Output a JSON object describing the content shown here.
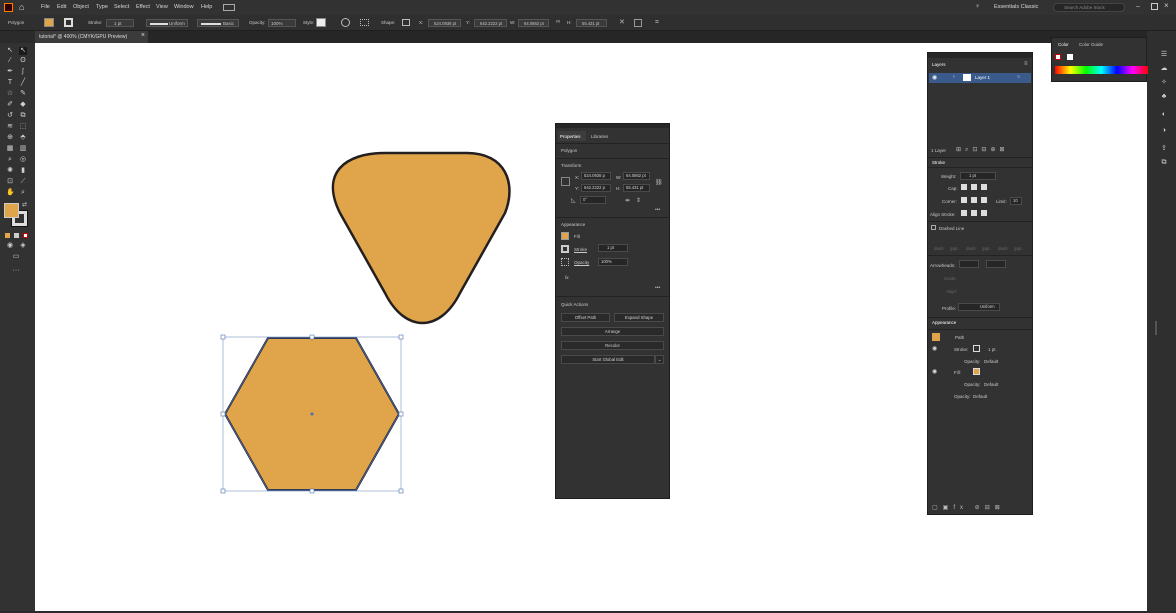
{
  "menu": {
    "app_icon": "illustrator-logo-icon",
    "items": [
      "File",
      "Edit",
      "Object",
      "Type",
      "Select",
      "Effect",
      "View",
      "Window",
      "Help"
    ],
    "workspace": "Essentials Classic",
    "search_placeholder": "Search Adobe Stock"
  },
  "control_bar": {
    "object_type": "Polygon",
    "stroke_label": "Stroke:",
    "stroke_value": "1 pt",
    "profile": "Uniform",
    "brush": "Basic",
    "opacity_label": "Opacity:",
    "opacity_value": "100%",
    "style_label": "Style:",
    "shape_label": "Shape:",
    "x_label": "X:",
    "x_value": "524.0938 pt",
    "y_label": "Y:",
    "y_value": "642.2222 pt",
    "w_label": "W:",
    "w_value": "64.0862 pt",
    "h_label": "H:",
    "h_value": "55.431 pt",
    "fill_color": "#e0a54a"
  },
  "document_tab": {
    "title": "tutorial* @ 400% (CMYK/GPU Preview)"
  },
  "properties_panel": {
    "tabs": [
      "Properties",
      "Libraries"
    ],
    "object_type": "Polygon",
    "transform_label": "Transform",
    "x_label": "X:",
    "x_value": "524.0938 p",
    "y_label": "Y:",
    "y_value": "642.2222 p",
    "w_label": "W:",
    "w_value": "64.0862 pt",
    "h_label": "H:",
    "h_value": "55.431 pt",
    "angle_value": "0°",
    "appearance_label": "Appearance",
    "fill_label": "Fill",
    "stroke_label": "Stroke",
    "stroke_value": "1 pt",
    "opacity_label": "Opacity",
    "opacity_value": "100%",
    "fx_label": "fx.",
    "quick_actions_label": "Quick Actions",
    "offset_path": "Offset Path",
    "expand_shape": "Expand Shape",
    "arrange": "Arrange",
    "recolor": "Recolor",
    "start_global_edit": "Start Global Edit"
  },
  "layers_panel": {
    "title": "Layers",
    "layer_name": "Layer 1",
    "layer_count": "1 Layer"
  },
  "stroke_panel": {
    "title": "Stroke",
    "weight_label": "Weight:",
    "weight_value": "1 pt",
    "cap_label": "Cap:",
    "corner_label": "Corner:",
    "limit_label": "Limit:",
    "limit_value": "10",
    "align_label": "Align Stroke:",
    "dashed_label": "Dashed Line",
    "dash_labels": [
      "dash",
      "gap",
      "dash",
      "gap",
      "dash",
      "gap"
    ],
    "arrowheads_label": "Arrowheads:",
    "scale_label": "Scale:",
    "align_arrow_label": "Align:",
    "profile_label": "Profile:",
    "profile_value": "Uniform"
  },
  "appearance_panel": {
    "title": "Appearance",
    "path_label": "Path",
    "stroke_label": "Stroke:",
    "stroke_value": "1 pt",
    "opacity_label": "Opacity:",
    "opacity_value": "Default",
    "fill_label": "Fill:",
    "fill_opacity_label": "Opacity:",
    "fill_opacity_value": "Default",
    "object_opacity_label": "Opacity:",
    "object_opacity_value": "Default"
  },
  "color_panel": {
    "tabs": [
      "Color",
      "Color Guide"
    ]
  },
  "colors": {
    "shape_fill": "#e0a54a",
    "shape_stroke": "#231f20",
    "selection": "#4a6fb5",
    "highlight": "#3a5a8c"
  }
}
